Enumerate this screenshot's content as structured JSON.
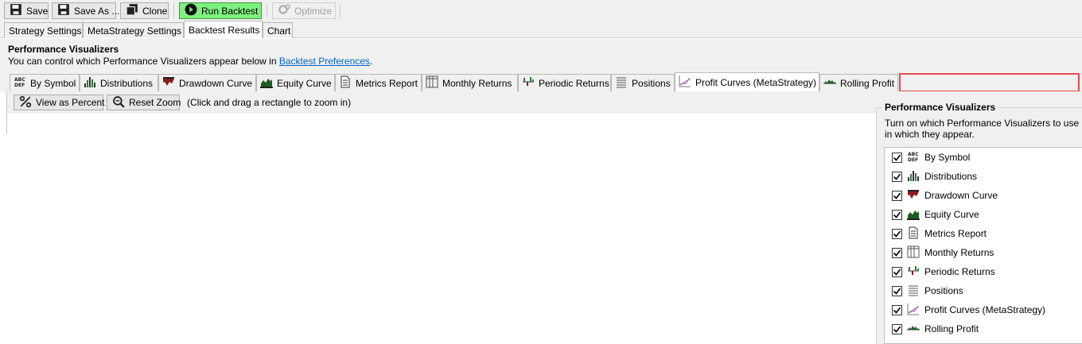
{
  "toolbar": {
    "save": "Save",
    "save_as": "Save As ...",
    "clone": "Clone",
    "run_backtest": "Run Backtest",
    "optimize": "Optimize"
  },
  "main_tabs": [
    "Strategy Settings",
    "MetaStrategy Settings",
    "Backtest Results",
    "Chart"
  ],
  "active_main_tab": "Backtest Results",
  "header": {
    "title": "Performance Visualizers",
    "desc_prefix": "You can control which Performance Visualizers appear below in ",
    "desc_link": "Backtest Preferences",
    "desc_suffix": "."
  },
  "viz_tabs": [
    {
      "label": "By Symbol",
      "icon": "abc-def-icon"
    },
    {
      "label": "Distributions",
      "icon": "distribution-bars-icon"
    },
    {
      "label": "Drawdown Curve",
      "icon": "drawdown-icon"
    },
    {
      "label": "Equity Curve",
      "icon": "equity-curve-icon"
    },
    {
      "label": "Metrics Report",
      "icon": "document-icon"
    },
    {
      "label": "Monthly Returns",
      "icon": "grid-columns-icon"
    },
    {
      "label": "Periodic Returns",
      "icon": "periodic-bars-icon"
    },
    {
      "label": "Positions",
      "icon": "list-lines-icon"
    },
    {
      "label": "Profit Curves (MetaStrategy)",
      "icon": "profit-curves-icon"
    },
    {
      "label": "Rolling Profit",
      "icon": "rolling-profit-icon"
    }
  ],
  "active_viz_tab": "Profit Curves (MetaStrategy)",
  "viz_content": {
    "view_as_percent": "View as Percent",
    "reset_zoom": "Reset Zoom",
    "zoom_hint": "(Click and drag a rectangle to zoom in)"
  },
  "preferences": {
    "title": "Performance Visualizers",
    "desc_line1": "Turn on which Performance Visualizers to use i",
    "desc_line2": "in which they appear.",
    "items": [
      {
        "label": "By Symbol",
        "checked": true,
        "icon": "abc-def-icon"
      },
      {
        "label": "Distributions",
        "checked": true,
        "icon": "distribution-bars-icon"
      },
      {
        "label": "Drawdown Curve",
        "checked": true,
        "icon": "drawdown-icon"
      },
      {
        "label": "Equity Curve",
        "checked": true,
        "icon": "equity-curve-icon"
      },
      {
        "label": "Metrics Report",
        "checked": true,
        "icon": "document-icon"
      },
      {
        "label": "Monthly Returns",
        "checked": true,
        "icon": "grid-columns-icon"
      },
      {
        "label": "Periodic Returns",
        "checked": true,
        "icon": "periodic-bars-icon"
      },
      {
        "label": "Positions",
        "checked": true,
        "icon": "list-lines-icon"
      },
      {
        "label": "Profit Curves (MetaStrategy)",
        "checked": true,
        "icon": "profit-curves-icon"
      },
      {
        "label": "Rolling Profit",
        "checked": true,
        "icon": "rolling-profit-icon"
      }
    ]
  },
  "colors": {
    "accent_link": "#0066cc",
    "run_button": "#7ef07e",
    "highlight": "#e84c4c"
  }
}
